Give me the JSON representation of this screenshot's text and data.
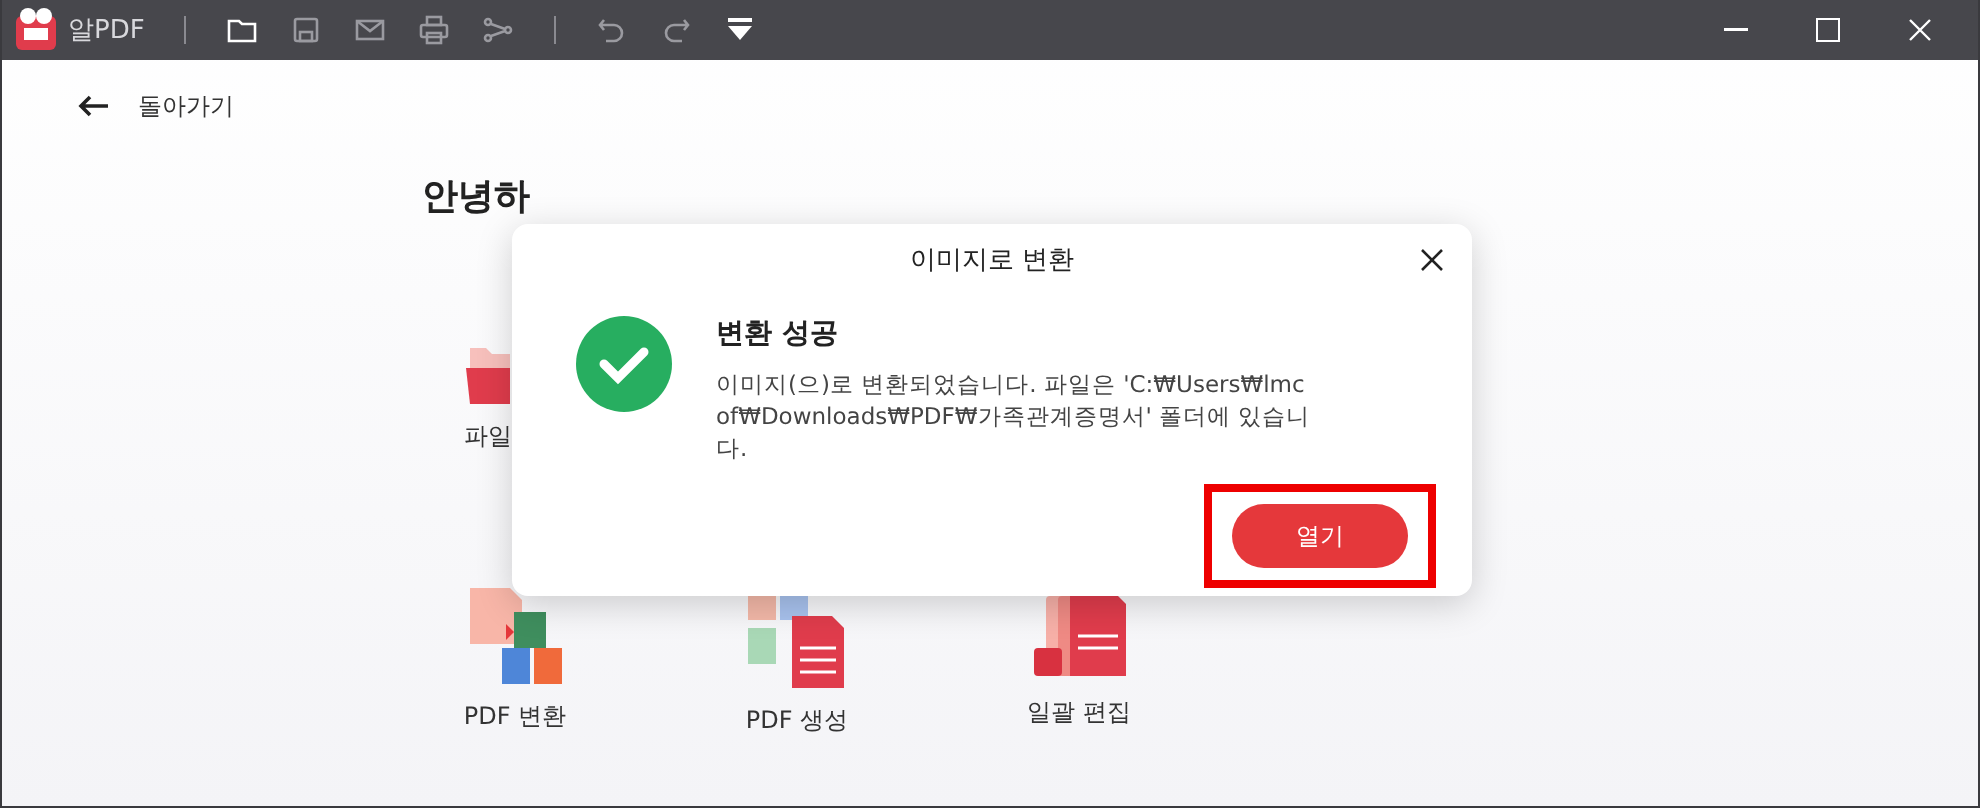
{
  "app": {
    "name": "알PDF"
  },
  "nav": {
    "back_label": "돌아가기"
  },
  "home": {
    "greeting": "안녕하",
    "tiles": [
      {
        "kind": "open",
        "label": "파일"
      }
    ],
    "tools": [
      {
        "kind": "convert",
        "label": "PDF 변환"
      },
      {
        "kind": "create",
        "label": "PDF 생성"
      },
      {
        "kind": "batch",
        "label": "일괄 편집"
      }
    ]
  },
  "dialog": {
    "title": "이미지로 변환",
    "heading": "변환 성공",
    "message": "이미지(으)로 변환되었습니다. 파일은 'C:₩Users₩lmcof₩Downloads₩PDF₩가족관계증명서' 폴더에 있습니다.",
    "button": "열기",
    "button_highlighted": true
  }
}
